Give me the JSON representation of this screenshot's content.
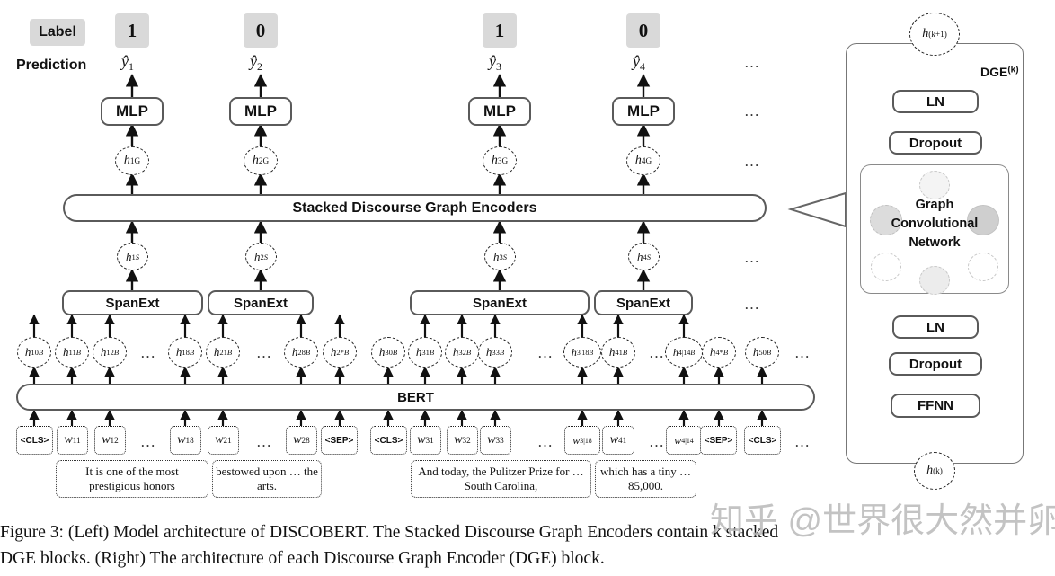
{
  "figure": {
    "caption_line1": "Figure 3: (Left) Model architecture of DISCOBERT. The Stacked Discourse Graph Encoders contain k stacked",
    "caption_line2": "DGE blocks. (Right) The architecture of each Discourse Graph Encoder (DGE) block.",
    "caption_prefix": "Figure 3:",
    "watermark": "知乎 @世界很大然并卵"
  },
  "left": {
    "row_label_title": "Label",
    "row_prediction_title": "Prediction",
    "labels": [
      "1",
      "0",
      "1",
      "0"
    ],
    "predictions": [
      "ŷ1",
      "ŷ2",
      "ŷ3",
      "ŷ4"
    ],
    "mlp_label": "MLP",
    "mlp_count": 4,
    "graph_nodes": [
      "h1G",
      "h2G",
      "h3G",
      "h4G"
    ],
    "encoder_bar_label": "Stacked Discourse Graph Encoders",
    "span_nodes": [
      "h1S",
      "h2S",
      "h3S",
      "h4S"
    ],
    "spanext_label": "SpanExt",
    "spanext_count": 4,
    "bert_label": "BERT",
    "hidden_states": [
      {
        "base": "h",
        "sup": "B",
        "sub": "10"
      },
      {
        "base": "h",
        "sup": "B",
        "sub": "11"
      },
      {
        "base": "h",
        "sup": "B",
        "sub": "12"
      },
      {
        "base": "h",
        "sup": "B",
        "sub": "18"
      },
      {
        "base": "h",
        "sup": "B",
        "sub": "21"
      },
      {
        "base": "h",
        "sup": "B",
        "sub": "28"
      },
      {
        "base": "h",
        "sup": "B",
        "sub": "2*"
      },
      {
        "base": "h",
        "sup": "B",
        "sub": "30"
      },
      {
        "base": "h",
        "sup": "B",
        "sub": "31"
      },
      {
        "base": "h",
        "sup": "B",
        "sub": "32"
      },
      {
        "base": "h",
        "sup": "B",
        "sub": "33"
      },
      {
        "base": "h",
        "sup": "B",
        "sub": "3|18"
      },
      {
        "base": "h",
        "sup": "B",
        "sub": "41"
      },
      {
        "base": "h",
        "sup": "B",
        "sub": "4|14"
      },
      {
        "base": "h",
        "sup": "B",
        "sub": "4*"
      },
      {
        "base": "h",
        "sup": "B",
        "sub": "50"
      }
    ],
    "tokens": [
      {
        "text": "<CLS>",
        "type": "special"
      },
      {
        "text": "w",
        "sub": "11",
        "type": "word"
      },
      {
        "text": "w",
        "sub": "12",
        "type": "word"
      },
      {
        "text": "w",
        "sub": "18",
        "type": "word"
      },
      {
        "text": "w",
        "sub": "21",
        "type": "word"
      },
      {
        "text": "w",
        "sub": "28",
        "type": "word"
      },
      {
        "text": "<SEP>",
        "type": "special"
      },
      {
        "text": "<CLS>",
        "type": "special"
      },
      {
        "text": "w",
        "sub": "31",
        "type": "word"
      },
      {
        "text": "w",
        "sub": "32",
        "type": "word"
      },
      {
        "text": "w",
        "sub": "33",
        "type": "word"
      },
      {
        "text": "w",
        "sub": "3|18",
        "type": "word"
      },
      {
        "text": "w",
        "sub": "41",
        "type": "word"
      },
      {
        "text": "w",
        "sub": "4|14",
        "type": "word"
      },
      {
        "text": "<SEP>",
        "type": "special"
      },
      {
        "text": "<CLS>",
        "type": "special"
      }
    ],
    "sentences": [
      "It is one of the most prestigious honors",
      "bestowed upon … the arts.",
      "And today, the Pulitzer Prize for … South Carolina,",
      "which has a tiny … 85,000."
    ],
    "ellipsis": "…"
  },
  "right": {
    "panel_title": "DGE(k)",
    "panel_title_base": "DGE",
    "panel_title_sup": "(k)",
    "output_node": "h(k+1)",
    "input_node": "h(k)",
    "blocks_top": [
      "LN",
      "Dropout"
    ],
    "gcn_label_lines": [
      "Graph",
      "Convolutional",
      "Network"
    ],
    "blocks_bottom": [
      "LN",
      "Dropout",
      "FFNN"
    ]
  },
  "colors": {
    "chip_bg": "#d9d9d9",
    "box_border": "#5a5a5a",
    "panel_border": "#777777",
    "node_fill_dark": "#c9c9c9",
    "node_fill_light": "#e8e8e8",
    "text": "#111111",
    "watermark": "#b9b9b9"
  }
}
